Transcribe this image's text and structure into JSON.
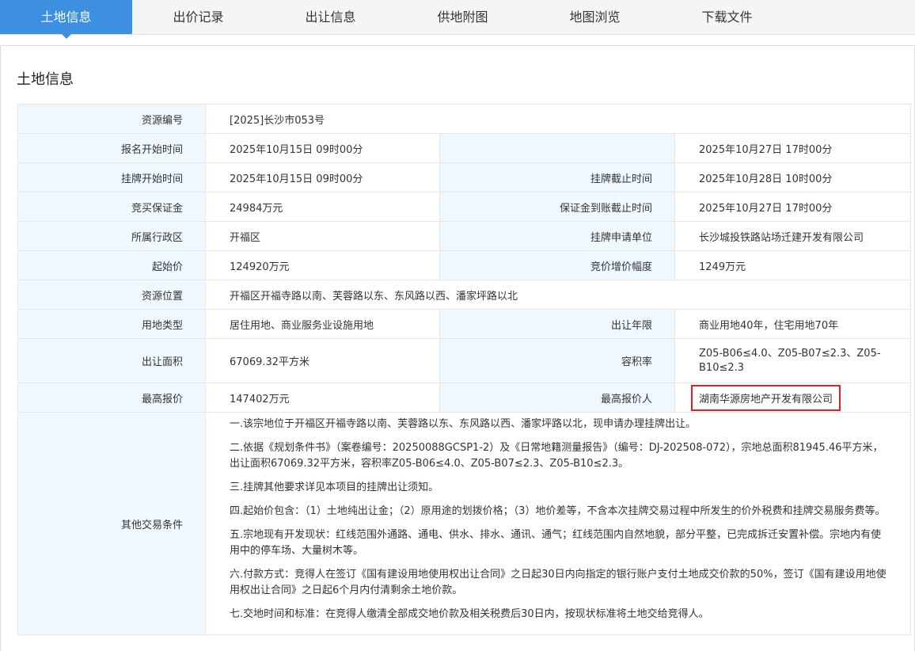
{
  "tabs": [
    "土地信息",
    "出价记录",
    "出让信息",
    "供地附图",
    "地图浏览",
    "下载文件"
  ],
  "panel_title": "土地信息",
  "rows": {
    "resource_no": {
      "label": "资源编号",
      "value": "[2025]长沙市053号"
    },
    "signup_start": {
      "label": "报名开始时间",
      "value": "2025年10月15日 09时00分"
    },
    "signup_end_value": "2025年10月27日 17时00分",
    "listing_start": {
      "label": "挂牌开始时间",
      "value": "2025年10月15日 09时00分"
    },
    "listing_end": {
      "label": "挂牌截止时间",
      "value": "2025年10月28日 10时00分"
    },
    "deposit": {
      "label": "竞买保证金",
      "value": "24984万元"
    },
    "deposit_deadline": {
      "label": "保证金到账截止时间",
      "value": "2025年10月27日 17时00分"
    },
    "district": {
      "label": "所属行政区",
      "value": "开福区"
    },
    "applicant": {
      "label": "挂牌申请单位",
      "value": "长沙城投铁路站场迁建开发有限公司"
    },
    "start_price": {
      "label": "起始价",
      "value": "124920万元"
    },
    "increment": {
      "label": "竞价增价幅度",
      "value": "1249万元"
    },
    "location": {
      "label": "资源位置",
      "value": "开福区开福寺路以南、芙蓉路以东、东风路以西、潘家坪路以北"
    },
    "land_use": {
      "label": "用地类型",
      "value": "居住用地、商业服务业设施用地"
    },
    "term": {
      "label": "出让年限",
      "value": "商业用地40年，住宅用地70年"
    },
    "area": {
      "label": "出让面积",
      "value": "67069.32平方米"
    },
    "far": {
      "label": "容积率",
      "value": "Z05-B06≤4.0、Z05-B07≤2.3、Z05-B10≤2.3"
    },
    "top_price": {
      "label": "最高报价",
      "value": "147402万元"
    },
    "top_bidder": {
      "label": "最高报价人",
      "value": "湖南华源房地产开发有限公司"
    },
    "other_conditions": {
      "label": "其他交易条件",
      "items": [
        "一.该宗地位于开福区开福寺路以南、芙蓉路以东、东风路以西、潘家坪路以北，现申请办理挂牌出让。",
        "二.依据《规划条件书》（案卷编号：20250088GCSP1-2）及《日常地籍测量报告》（编号：DJ-202508-072），宗地总面积81945.46平方米，出让面积67069.32平方米，容积率Z05-B06≤4.0、Z05-B07≤2.3、Z05-B10≤2.3。",
        "三.挂牌其他要求详见本项目的挂牌出让须知。",
        "四.起始价包含：（1）土地纯出让金；（2）原用途的划拨价格；（3）地价差等，不含本次挂牌交易过程中所发生的价外税费和挂牌交易服务费等。",
        "五.宗地现有开发现状：红线范围外通路、通电、供水、排水、通讯、通气；红线范围内自然地貌，部分平整，已完成拆迁安置补偿。宗地内有使用中的停车场、大量树木等。",
        "六.付款方式：竞得人在签订《国有建设用地使用权出让合同》之日起30日内向指定的银行账户支付土地成交价款的50%，签订《国有建设用地使用权出让合同》之日起6个月内付清剩余土地价款。",
        "七.交地时间和标准：在竞得人缴清全部成交地价款及相关税费后30日内，按现状标准将土地交给竞得人。"
      ]
    }
  },
  "colors": {
    "tab_active": "#3d8fe0",
    "label_bg": "#f0f8ff",
    "highlight_border": "#e02020"
  }
}
